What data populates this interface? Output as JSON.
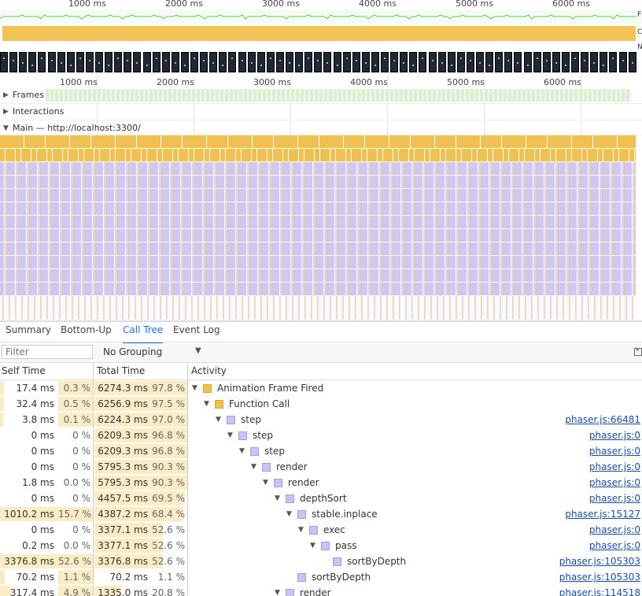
{
  "overview": {
    "ruler_labels": [
      "1000 ms",
      "2000 ms",
      "3000 ms",
      "4000 ms",
      "5000 ms",
      "6000 ms"
    ],
    "fps_letter": "F",
    "cpu_letter": "C",
    "net_letter": "N"
  },
  "timeline": {
    "ruler_labels": [
      "1000 ms",
      "2000 ms",
      "3000 ms",
      "4000 ms",
      "5000 ms",
      "6000 ms"
    ],
    "frames_label": "Frames",
    "interactions_label": "Interactions",
    "main_label": "Main — http://localhost:3300/"
  },
  "tabs": [
    "Summary",
    "Bottom-Up",
    "Call Tree",
    "Event Log"
  ],
  "active_tab": "Call Tree",
  "toolbar": {
    "filter_placeholder": "Filter",
    "grouping_value": "No Grouping"
  },
  "table": {
    "headers": {
      "self": "Self Time",
      "total": "Total Time",
      "activity": "Activity"
    },
    "rows": [
      {
        "self": "17.4 ms",
        "self_pct": "0.3 %",
        "self_frac": 0.003,
        "total": "6274.3 ms",
        "total_pct": "97.8 %",
        "total_frac": 0.978,
        "depth": 0,
        "toggle": "▼",
        "name": "Animation Frame Fired",
        "color": "#f0c050",
        "link": ""
      },
      {
        "self": "32.4 ms",
        "self_pct": "0.5 %",
        "self_frac": 0.005,
        "total": "6256.9 ms",
        "total_pct": "97.5 %",
        "total_frac": 0.975,
        "depth": 1,
        "toggle": "▼",
        "name": "Function Call",
        "color": "#f0c050",
        "link": ""
      },
      {
        "self": "3.8 ms",
        "self_pct": "0.1 %",
        "self_frac": 0.001,
        "total": "6224.3 ms",
        "total_pct": "97.0 %",
        "total_frac": 0.97,
        "depth": 2,
        "toggle": "▼",
        "name": "step",
        "color": "#c9c2f2",
        "link": "phaser.js:66481"
      },
      {
        "self": "0 ms",
        "self_pct": "0 %",
        "self_frac": 0,
        "total": "6209.3 ms",
        "total_pct": "96.8 %",
        "total_frac": 0.968,
        "depth": 3,
        "toggle": "▼",
        "name": "step",
        "color": "#c9c2f2",
        "link": "phaser.js:0"
      },
      {
        "self": "0 ms",
        "self_pct": "0 %",
        "self_frac": 0,
        "total": "6209.3 ms",
        "total_pct": "96.8 %",
        "total_frac": 0.968,
        "depth": 4,
        "toggle": "▼",
        "name": "step",
        "color": "#c9c2f2",
        "link": "phaser.js:0"
      },
      {
        "self": "0 ms",
        "self_pct": "0 %",
        "self_frac": 0,
        "total": "5795.3 ms",
        "total_pct": "90.3 %",
        "total_frac": 0.903,
        "depth": 5,
        "toggle": "▼",
        "name": "render",
        "color": "#c9c2f2",
        "link": "phaser.js:0"
      },
      {
        "self": "1.8 ms",
        "self_pct": "0.0 %",
        "self_frac": 0,
        "total": "5795.3 ms",
        "total_pct": "90.3 %",
        "total_frac": 0.903,
        "depth": 6,
        "toggle": "▼",
        "name": "render",
        "color": "#c9c2f2",
        "link": "phaser.js:0"
      },
      {
        "self": "0 ms",
        "self_pct": "0 %",
        "self_frac": 0,
        "total": "4457.5 ms",
        "total_pct": "69.5 %",
        "total_frac": 0.695,
        "depth": 7,
        "toggle": "▼",
        "name": "depthSort",
        "color": "#c9c2f2",
        "link": "phaser.js:0"
      },
      {
        "self": "1010.2 ms",
        "self_pct": "15.7 %",
        "self_frac": 0.157,
        "total": "4387.2 ms",
        "total_pct": "68.4 %",
        "total_frac": 0.684,
        "depth": 8,
        "toggle": "▼",
        "name": "stable.inplace",
        "color": "#c9c2f2",
        "link": "phaser.js:15127"
      },
      {
        "self": "0 ms",
        "self_pct": "0 %",
        "self_frac": 0,
        "total": "3377.1 ms",
        "total_pct": "52.6 %",
        "total_frac": 0.526,
        "depth": 9,
        "toggle": "▼",
        "name": "exec",
        "color": "#c9c2f2",
        "link": "phaser.js:0"
      },
      {
        "self": "0.2 ms",
        "self_pct": "0.0 %",
        "self_frac": 0,
        "total": "3377.1 ms",
        "total_pct": "52.6 %",
        "total_frac": 0.526,
        "depth": 10,
        "toggle": "▼",
        "name": "pass",
        "color": "#c9c2f2",
        "link": "phaser.js:0"
      },
      {
        "self": "3376.8 ms",
        "self_pct": "52.6 %",
        "self_frac": 0.526,
        "total": "3376.8 ms",
        "total_pct": "52.6 %",
        "total_frac": 0.526,
        "depth": 11,
        "toggle": "",
        "name": "sortByDepth",
        "color": "#c9c2f2",
        "link": "phaser.js:105303"
      },
      {
        "self": "70.2 ms",
        "self_pct": "1.1 %",
        "self_frac": 0.011,
        "total": "70.2 ms",
        "total_pct": "1.1 %",
        "total_frac": 0.011,
        "depth": 8,
        "toggle": "",
        "name": "sortByDepth",
        "color": "#c9c2f2",
        "link": "phaser.js:105303"
      },
      {
        "self": "317.4 ms",
        "self_pct": "4.9 %",
        "self_frac": 0.049,
        "total": "1335.0 ms",
        "total_pct": "20.8 %",
        "total_frac": 0.208,
        "depth": 7,
        "toggle": "▼",
        "name": "render",
        "color": "#c9c2f2",
        "link": "phaser.js:114518"
      }
    ]
  }
}
